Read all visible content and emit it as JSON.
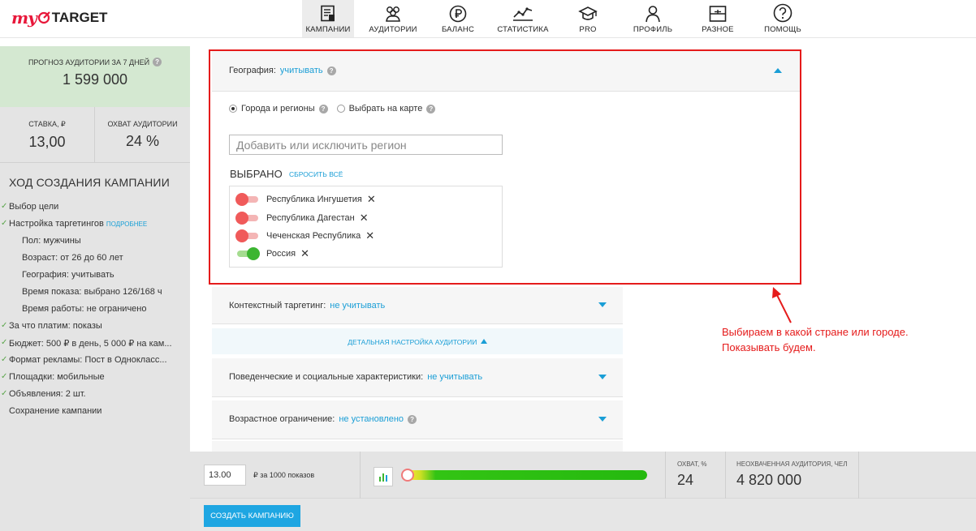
{
  "logo": {
    "my": "my",
    "target": "TARGET"
  },
  "nav": {
    "items": [
      {
        "label": "КАМПАНИИ",
        "icon": "campaigns-icon",
        "active": true
      },
      {
        "label": "АУДИТОРИИ",
        "icon": "audiences-icon"
      },
      {
        "label": "БАЛАНС",
        "icon": "ruble-icon"
      },
      {
        "label": "СТАТИСТИКА",
        "icon": "stats-icon"
      },
      {
        "label": "PRO",
        "icon": "graduation-cap-icon"
      },
      {
        "label": "ПРОФИЛЬ",
        "icon": "profile-icon"
      },
      {
        "label": "РАЗНОЕ",
        "icon": "misc-icon"
      },
      {
        "label": "ПОМОЩЬ",
        "icon": "help-icon"
      }
    ]
  },
  "sidebar": {
    "forecast_label": "ПРОГНОЗ АУДИТОРИИ ЗА 7 ДНЕЙ",
    "forecast_value": "1 599 000",
    "rate_label": "СТАВКА, ₽",
    "rate_value": "13,00",
    "coverage_label": "ОХВАТ АУДИТОРИИ",
    "coverage_value": "24 %",
    "progress_title": "ХОД СОЗДАНИЯ КАМПАНИИ",
    "more_link": "ПОДРОБНЕЕ",
    "steps": [
      "Выбор цели",
      "Настройка таргетингов",
      "Пол: мужчины",
      "Возраст: от 26 до 60 лет",
      "География: учитывать",
      "Время показа: выбрано 126/168 ч",
      "Время работы: не ограничено",
      "За что платим: показы",
      "Бюджет: 500 ₽ в день, 5 000 ₽ на кам...",
      "Формат рекламы: Пост в Однокласс...",
      "Площадки: мобильные",
      "Объявления: 2 шт.",
      "Сохранение кампании"
    ]
  },
  "geo": {
    "label": "География:",
    "value": "учитывать",
    "option_cities": "Города и регионы",
    "option_map": "Выбрать на карте",
    "input_placeholder": "Добавить или исключить регион",
    "selected_title": "ВЫБРАНО",
    "reset": "СБРОСИТЬ ВСЁ",
    "regions": [
      {
        "name": "Республика Ингушетия",
        "included": false
      },
      {
        "name": "Республика Дагестан",
        "included": false
      },
      {
        "name": "Чеченская Республика",
        "included": false
      },
      {
        "name": "Россия",
        "included": true
      }
    ]
  },
  "context": {
    "label": "Контекстный таргетинг:",
    "value": "не учитывать"
  },
  "detail_link": "ДЕТАЛЬНАЯ НАСТРОЙКА АУДИТОРИИ",
  "behavior": {
    "label": "Поведенческие и социальные характеристики:",
    "value": "не учитывать"
  },
  "age_limit": {
    "label": "Возрастное ограничение:",
    "value": "не установлено"
  },
  "annotation": {
    "line1": "Выбираем в какой стране или городе.",
    "line2": "Показывать будем."
  },
  "bottom": {
    "bid_value": "13.00",
    "bid_label": "₽ за 1000 показов",
    "coverage_label": "ОХВАТ, %",
    "coverage_value": "24",
    "unreached_label": "НЕОХВАЧЕННАЯ АУДИТОРИЯ, ЧЕЛ",
    "unreached_value": "4 820 000",
    "create_button": "СОЗДАТЬ КАМПАНИЮ"
  },
  "colors": {
    "accent": "#1a9ed6",
    "highlight": "#e51b1b",
    "included": "#3cb531",
    "excluded": "#f05a5a"
  }
}
